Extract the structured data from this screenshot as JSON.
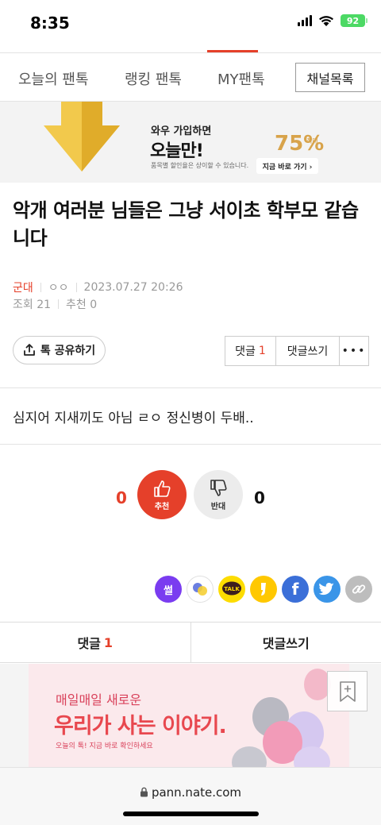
{
  "status_bar": {
    "time": "8:35",
    "battery": "92"
  },
  "top_nav": {
    "tabs": [
      "오늘의 팬톡",
      "랭킹 팬톡",
      "MY팬톡"
    ],
    "channel_button": "채널목록"
  },
  "ad_banner": {
    "line1": "와우 가입하면",
    "line2": "오늘만!",
    "note": "품목별 할인율은 상이할 수 있습니다.",
    "percent": "75%",
    "percent_small": "최대",
    "cta": "지금 바로 가기 ›"
  },
  "post": {
    "title": "악개 여러분 님들은 그냥 서이초 학부모 같습니다",
    "category": "군대",
    "author": "ㅇㅇ",
    "datetime": "2023.07.27 20:26",
    "views": "조회 21",
    "recommends": "추천 0",
    "body": "심지어 지새끼도 아님 ㄹㅇ 정신병이 두배.."
  },
  "actions": {
    "share": "톡 공유하기",
    "comment_label": "댓글",
    "comment_count": "1",
    "write_label": "댓글쓰기",
    "more": "•••"
  },
  "vote": {
    "up_count": "0",
    "up_label": "추천",
    "down_label": "반대",
    "down_count": "0"
  },
  "sns": {
    "ssul": "썰",
    "talk": "TALK",
    "facebook": "f"
  },
  "bottom_tabs": {
    "comment_label": "댓글",
    "comment_count": "1",
    "write_label": "댓글쓰기"
  },
  "ad2": {
    "line1": "매일매일 새로운",
    "line2": "우리가 사는 이야기.",
    "line3": "오늘의 톡! 지금 바로 확인하세요"
  },
  "url_bar": {
    "url": "pann.nate.com"
  },
  "colors": {
    "accent": "#e5402a",
    "ssul": "#7a3cf0",
    "kakao": "#fddc00",
    "facebook": "#3b6fd8",
    "twitter": "#3a95e8"
  }
}
